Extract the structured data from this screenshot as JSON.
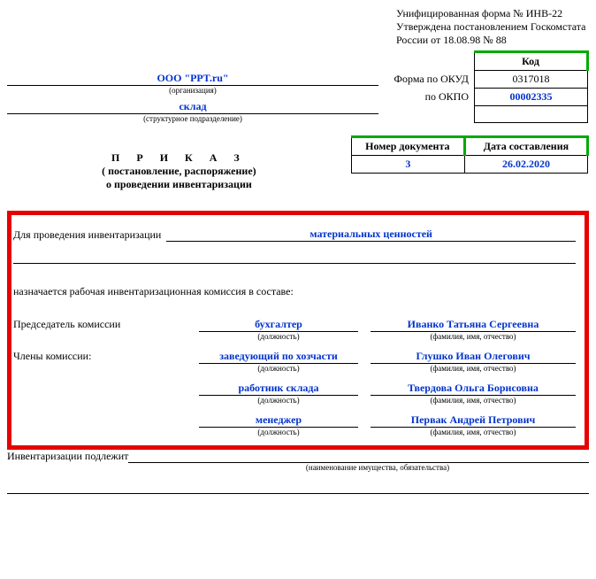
{
  "header_note": {
    "line1": "Унифицированная форма № ИНВ-22",
    "line2": "Утверждена постановлением Госкомстата",
    "line3": "России от 18.08.98 № 88"
  },
  "org": {
    "name": "ООО \"PPT.ru\"",
    "name_hint": "(организация)",
    "subdivision": "склад",
    "subdivision_hint": "(структурное подразделение)"
  },
  "codes": {
    "code_header": "Код",
    "okud_label": "Форма по ОКУД",
    "okud_value": "0317018",
    "okpo_label": "по ОКПО",
    "okpo_value": "00002335"
  },
  "doc_title": {
    "main": "П Р И К А З",
    "sub1": "( постановление, распоряжение)",
    "sub2": "о проведении инвентаризации"
  },
  "docnum": {
    "num_header": "Номер документа",
    "date_header": "Дата составления",
    "num_value": "3",
    "date_value": "26.02.2020"
  },
  "body": {
    "intro_label": "Для проведения инвентаризации",
    "intro_value": "материальных ценностей",
    "appoint_text": "назначается рабочая инвентаризационная комиссия в составе:",
    "chairman_label": "Председатель комиссии",
    "members_label": "Члены комиссии:",
    "pos_hint": "(должность)",
    "name_hint": "(фамилия, имя, отчество)",
    "rows": [
      {
        "position": "бухгалтер",
        "name": "Иванко Татьяна Сергеевна"
      },
      {
        "position": "заведующий по хозчасти",
        "name": "Глушко Иван Олегович"
      },
      {
        "position": "работник склада",
        "name": "Твердова Ольга Борисовна"
      },
      {
        "position": "менеджер",
        "name": "Первак Андрей Петрович"
      }
    ]
  },
  "footer": {
    "label": "Инвентаризации подлежит",
    "hint": "(наименование имущества, обязательства)"
  }
}
